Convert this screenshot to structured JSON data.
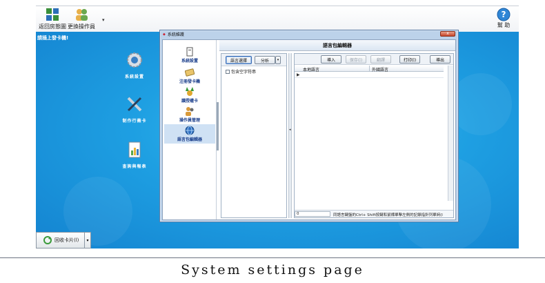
{
  "toolbar": {
    "home_label": "返回房態圖",
    "switch_operator_label": "更換操作員",
    "help_label": "幫 助"
  },
  "desktop": {
    "prompt": "請插上發卡機!",
    "icons": [
      {
        "label": "系統設置",
        "icon": "gear-icon"
      },
      {
        "label": "制作行蕪卡",
        "icon": "tools-icon"
      },
      {
        "label": "查詢與報表",
        "icon": "report-icon"
      }
    ],
    "recycle_button": "回收卡片(l)"
  },
  "dialog": {
    "title": "系統維護",
    "close_glyph": "x",
    "nav": [
      {
        "label": "系統設置",
        "icon": "settings-doc-icon"
      },
      {
        "label": "注冊發卡機",
        "icon": "card-icon"
      },
      {
        "label": "讀授權卡",
        "icon": "medal-icon"
      },
      {
        "label": "操作員管理",
        "icon": "users-icon"
      },
      {
        "label": "語言包編輯器",
        "icon": "globe-icon",
        "selected": true
      }
    ],
    "editor": {
      "title": "語言包編輯器",
      "language_select": "語言選擇",
      "analyze": "分析",
      "include_empty": "包含空字符串",
      "import": "導入",
      "save": "保存(l)",
      "translate": "翻譯",
      "print": "打印(l)",
      "export": "導出",
      "columns": [
        "本地語言",
        "外國語言"
      ],
      "row_marker": "▶",
      "status_count": "0",
      "status_hint": "同語言鍵盤的Ctrl+ Shift按鍵和鼠標單擊左側的記錄指針列單詞(l"
    }
  },
  "caption": "System settings page"
}
